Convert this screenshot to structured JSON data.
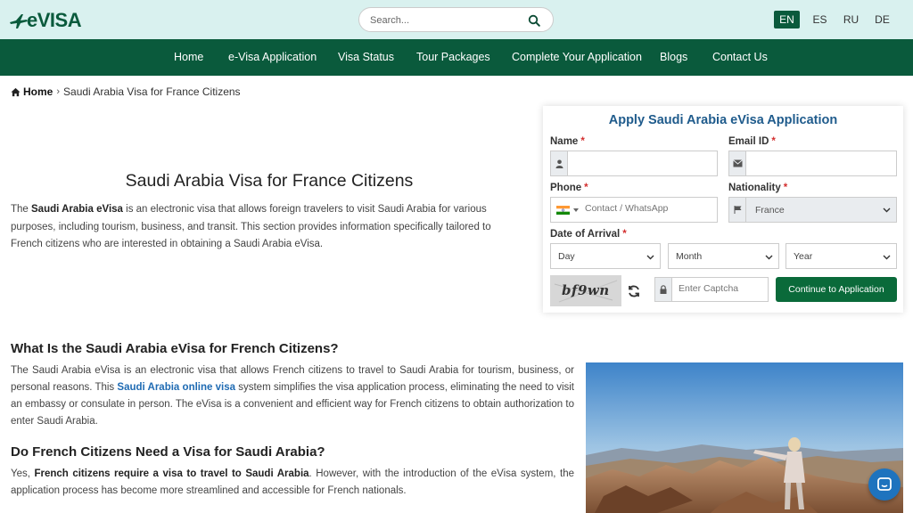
{
  "header": {
    "logo_text": "eVISA",
    "search_placeholder": "Search...",
    "languages": [
      "EN",
      "ES",
      "RU",
      "DE"
    ],
    "active_language": "EN"
  },
  "nav": {
    "items": [
      "Home",
      "e-Visa Application",
      "Visa Status",
      "Tour Packages",
      "Complete Your Application",
      "Blogs",
      "Contact Us"
    ]
  },
  "breadcrumb": {
    "home": "Home",
    "separator": "›",
    "current": "Saudi Arabia Visa for France Citizens"
  },
  "hero": {
    "title": "Saudi Arabia Visa for France Citizens",
    "para_prefix": "The ",
    "para_bold": "Saudi Arabia eVisa",
    "para_rest": " is an electronic visa that allows foreign travelers to visit Saudi Arabia for various purposes, including tourism, business, and transit. This section provides information specifically tailored to French citizens who are interested in obtaining a Saudi Arabia eVisa."
  },
  "form": {
    "title": "Apply Saudi Arabia eVisa Application",
    "name_label": "Name",
    "email_label": "Email ID",
    "phone_label": "Phone",
    "phone_placeholder": "Contact / WhatsApp",
    "nationality_label": "Nationality",
    "nationality_value": "France",
    "arrival_label": "Date of Arrival",
    "day": "Day",
    "month": "Month",
    "year": "Year",
    "captcha_text": "bf9wn",
    "captcha_placeholder": "Enter Captcha",
    "submit_label": "Continue to Application",
    "required_mark": "*"
  },
  "section1": {
    "heading": "What Is the Saudi Arabia eVisa for French Citizens?",
    "text_before": "The Saudi Arabia eVisa is an electronic visa that allows French citizens to travel to Saudi Arabia for tourism, business, or personal reasons. This ",
    "link": "Saudi Arabia online visa",
    "text_after": " system simplifies the visa application process, eliminating the need to visit an embassy or consulate in person. The eVisa is a convenient and efficient way for French citizens to obtain authorization to enter Saudi Arabia."
  },
  "section2": {
    "heading": "Do French Citizens Need a Visa for Saudi Arabia?",
    "text_before": "Yes, ",
    "bold": "French citizens require a visa to travel to Saudi Arabia",
    "text_after": ". However, with the introduction of the eVisa system, the application process has become more streamlined and accessible for French nationals."
  },
  "colors": {
    "topbar": "#d9f1ef",
    "nav": "#0a5a3c",
    "title_blue": "#1f5b8c",
    "button_green": "#0a6a3a",
    "link_blue": "#1f6bb3"
  }
}
